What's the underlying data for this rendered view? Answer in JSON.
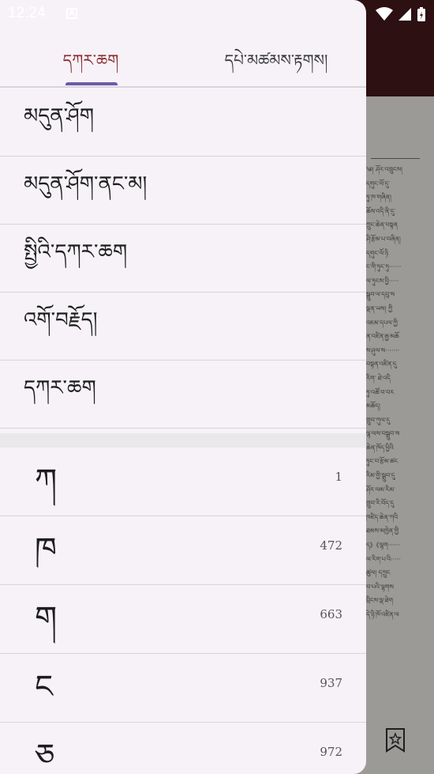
{
  "status_bar": {
    "time": "12:24",
    "notification_icon": "a-icon"
  },
  "tabs": [
    {
      "label": "དཀར་ཆག",
      "active": true
    },
    {
      "label": "དཔེ་མཚམས་རྟགས།",
      "active": false
    }
  ],
  "menu": [
    {
      "label": "མདུན་ཤོག"
    },
    {
      "label": "མདུན་ཤོག་ནང་མ།"
    },
    {
      "label": "སྤྱིའི་དཀར་ཆག"
    },
    {
      "label": "འགོ་བརྗོད།"
    },
    {
      "label": "དཀར་ཆག"
    }
  ],
  "index": [
    {
      "letter": "ཀ",
      "page": "1"
    },
    {
      "letter": "ཁ",
      "page": "472"
    },
    {
      "letter": "ག",
      "page": "663"
    },
    {
      "letter": "ང",
      "page": "937"
    },
    {
      "letter": "ཅ",
      "page": "972"
    }
  ],
  "colors": {
    "accent": "#6e5aa8",
    "active_tab": "#8a2a2e",
    "topbar": "#4a1a1c"
  }
}
